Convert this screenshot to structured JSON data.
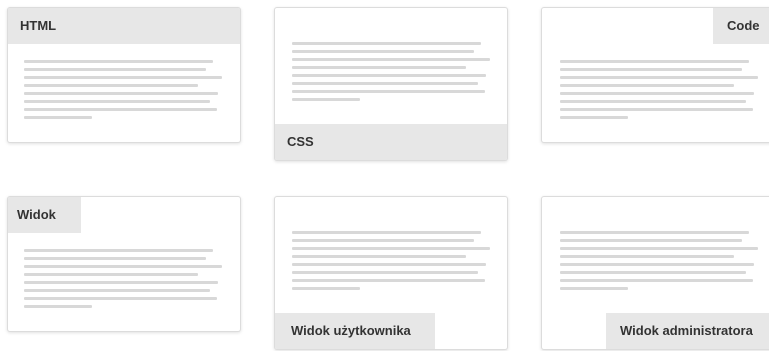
{
  "cards": [
    {
      "label": "HTML"
    },
    {
      "label": "CSS"
    },
    {
      "label": "Code"
    },
    {
      "label": "Widok"
    },
    {
      "label": "Widok użytkownika"
    },
    {
      "label": "Widok administratora"
    }
  ]
}
